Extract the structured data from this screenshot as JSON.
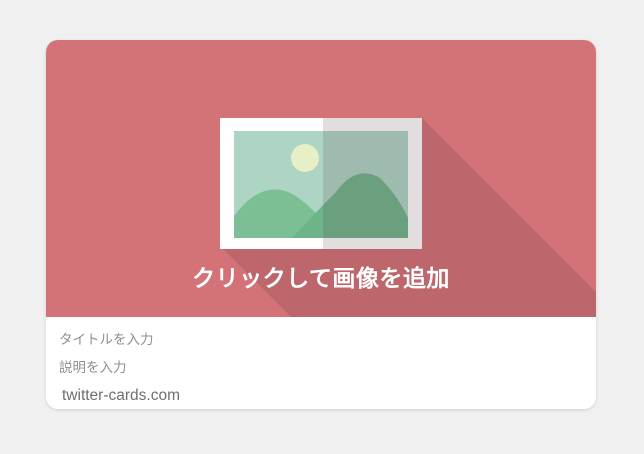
{
  "card": {
    "image_label": "クリックして画像を追加",
    "title_placeholder": "タイトルを入力",
    "description_placeholder": "説明を入力",
    "domain": "twitter-cards.com"
  },
  "colors": {
    "page_background": "#f0f0f0",
    "image_background": "#d37378",
    "long_shadow": "#bd676c",
    "placeholder_frame": "#ffffff",
    "placeholder_sky": "#aed4c4",
    "placeholder_hill": "#7cbf95",
    "placeholder_sun": "#e7efc7",
    "placeholder_text": "#8f8f8f",
    "domain_text": "#6f6f6f"
  },
  "icons": {
    "image_placeholder": "image-placeholder-icon"
  }
}
